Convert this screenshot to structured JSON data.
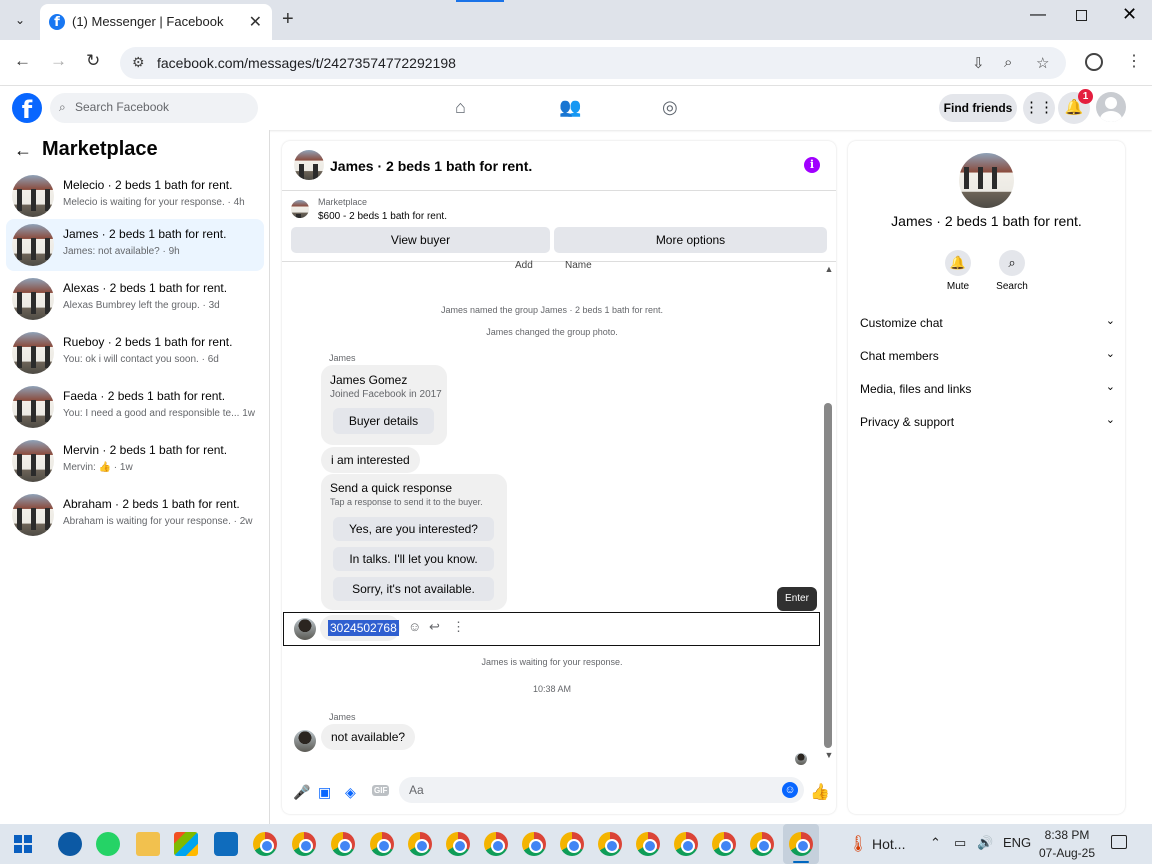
{
  "browser": {
    "tab_title": "(1) Messenger | Facebook",
    "url": "facebook.com/messages/t/24273574772292198",
    "icons": [
      "tab-dropdown-icon",
      "close-icon",
      "new-tab-icon",
      "back-icon",
      "forward-icon",
      "reload-icon",
      "site-info-icon",
      "install-icon",
      "zoom-icon",
      "star-icon",
      "profile-icon",
      "menu-icon"
    ]
  },
  "fb": {
    "search_placeholder": "Search Facebook",
    "find_friends": "Find friends",
    "notification_count": "1",
    "brand_color": "#0866ff"
  },
  "sidebar": {
    "title": "Marketplace",
    "conversations": [
      {
        "name": "Melecio · 2 beds 1 bath for rent.",
        "snippet": "Melecio is waiting for your response. · 4h"
      },
      {
        "name": "James · 2 beds 1 bath for rent.",
        "snippet": "James: not available? · 9h",
        "active": true
      },
      {
        "name": "Alexas · 2 beds 1 bath for rent.",
        "snippet": "Alexas Bumbrey left the group. · 3d"
      },
      {
        "name": "Rueboy · 2 beds 1 bath for rent.",
        "snippet": "You: ok i will contact you soon. · 6d"
      },
      {
        "name": "Faeda · 2 beds 1 bath for rent.",
        "snippet": "You: I need a good and responsible te... 1w"
      },
      {
        "name": "Mervin · 2 beds 1 bath for rent.",
        "snippet": "Mervin: 👍 · 1w"
      },
      {
        "name": "Abraham · 2 beds 1 bath for rent.",
        "snippet": "Abraham is waiting for your response. · 2w"
      }
    ]
  },
  "chat": {
    "title": "James · 2 beds 1 bath for rent.",
    "marketplace_label": "Marketplace",
    "listing": "$600 - 2 beds 1 bath for rent.",
    "view_buyer": "View buyer",
    "more_options": "More options",
    "cutoff_add": "Add",
    "cutoff_name": "Name",
    "sys1": "James named the group James · 2 beds 1 bath for rent.",
    "sys2": "James changed the group photo.",
    "sender1": "James",
    "buyer_name": "James Gomez",
    "buyer_joined": "Joined Facebook in 2017",
    "buyer_details": "Buyer details",
    "msg_interested": "i am interested",
    "quick_title": "Send a quick response",
    "quick_sub": "Tap a response to send it to the buyer.",
    "quick_1": "Yes, are you interested?",
    "quick_2": "In talks. I'll let you know.",
    "quick_3": "Sorry, it's not available.",
    "tooltip": "Enter",
    "phone_msg": "3024502768",
    "waiting": "James is waiting for your response.",
    "time": "10:38 AM",
    "sender2": "James",
    "msg_not_available": "not available?",
    "input_placeholder": "Aa"
  },
  "right_panel": {
    "name": "James · 2 beds 1 bath for rent.",
    "mute": "Mute",
    "search": "Search",
    "sections": [
      "Customize chat",
      "Chat members",
      "Media, files and links",
      "Privacy & support"
    ]
  },
  "taskbar": {
    "weather": "Hot...",
    "lang": "ENG",
    "time": "8:38 PM",
    "date": "07-Aug-25"
  }
}
